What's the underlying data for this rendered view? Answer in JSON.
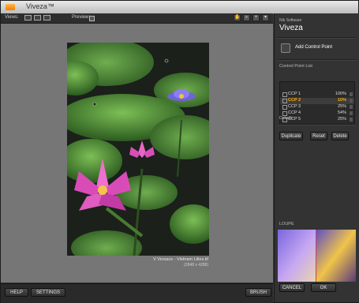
{
  "app": {
    "title": "Viveza™"
  },
  "toolbar": {
    "views_label": "Views:",
    "preview_label": "Preview:"
  },
  "caption": {
    "name": "V Versace - Vietnam Lilies.tif",
    "size": "(2848 x 4288)"
  },
  "bottom": {
    "help": "HELP",
    "settings": "SETTINGS",
    "brush": "BRUSH",
    "cancel": "CANCEL",
    "ok": "OK"
  },
  "sidebar": {
    "brand": "Nik Software",
    "product": "Viveza",
    "add_cp": "Add Control Point",
    "cp_list_title": "Control Point List",
    "details_title": "Details",
    "duplicate": "Duplicate",
    "reset": "Reset",
    "delete": "Delete",
    "loupe_title": "LOUPE",
    "cps": [
      {
        "name": "CCP 1",
        "value": "100%",
        "active": false
      },
      {
        "name": "CCP 2",
        "value": "10%",
        "active": true
      },
      {
        "name": "CCP 3",
        "value": "25%",
        "active": false
      },
      {
        "name": "CCP 4",
        "value": "54%",
        "active": false
      },
      {
        "name": "CCP 5",
        "value": "25%",
        "active": false
      }
    ]
  },
  "colors": {
    "accent": "#ffb000",
    "canvas": "#767676",
    "panel": "#333333"
  },
  "icons": [
    "view-single-icon",
    "view-split-icon",
    "view-side-icon",
    "preview-check-icon",
    "hand-tool-icon",
    "zoom-tool-icon",
    "control-point-tool-icon",
    "dropdown-icon"
  ]
}
